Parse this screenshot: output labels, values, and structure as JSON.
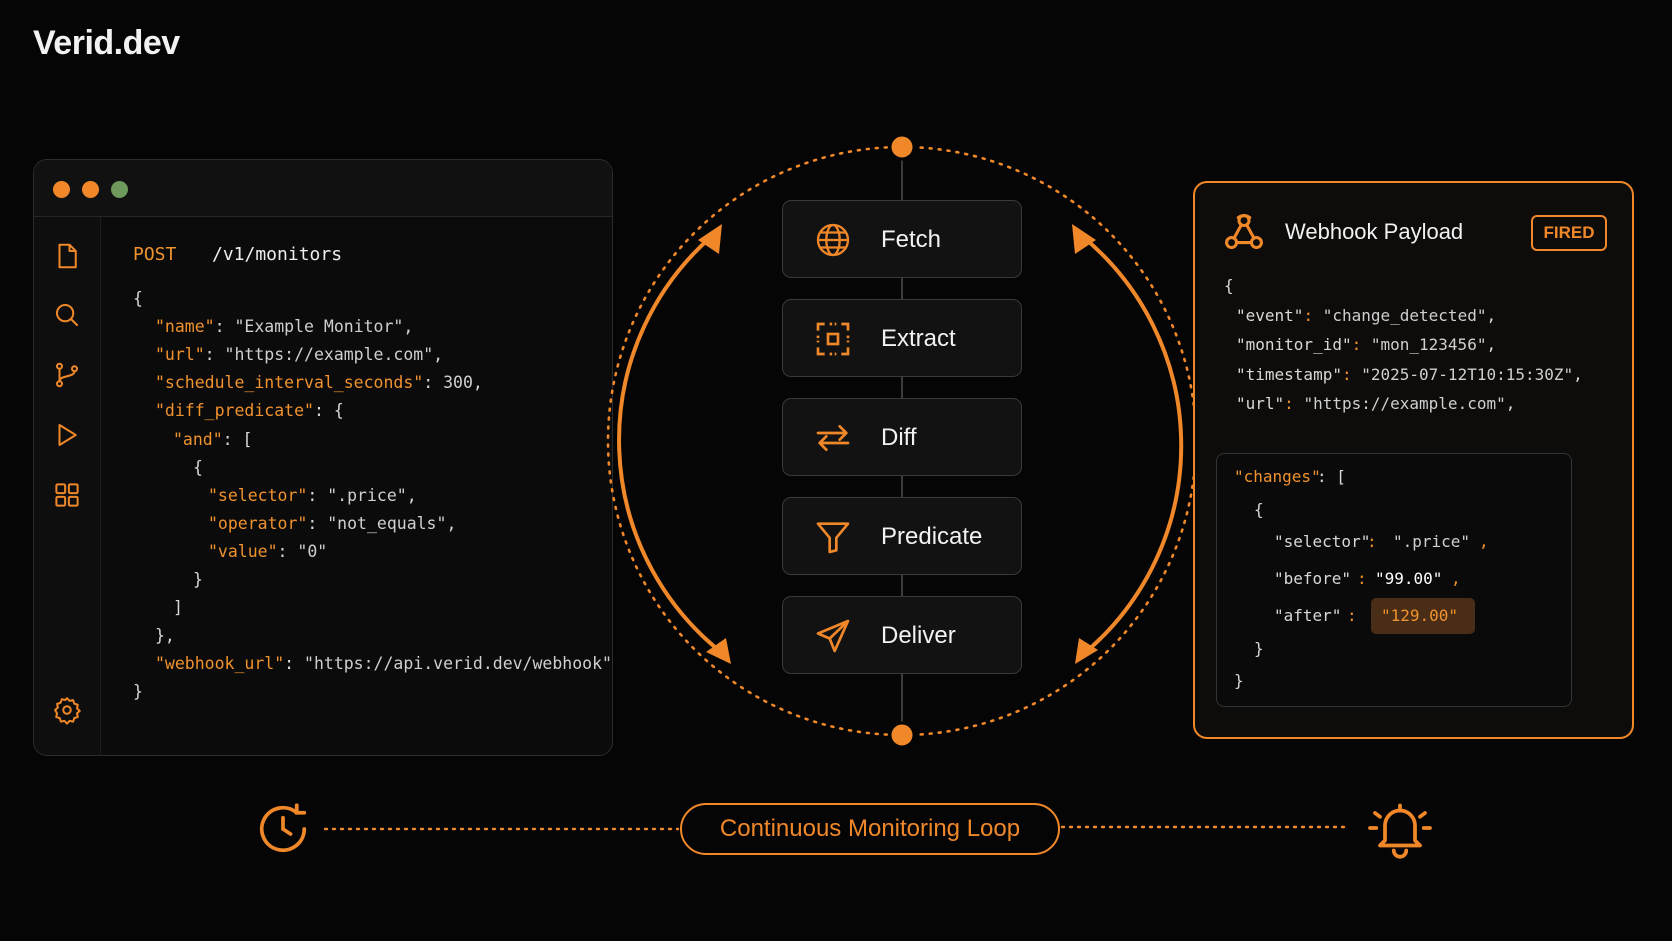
{
  "brand": "Verid.dev",
  "editor": {
    "method": "POST",
    "path": "/v1/monitors",
    "sidebar_icons": [
      "file-icon",
      "search-icon",
      "git-branch-icon",
      "play-icon",
      "grid-icon",
      "settings-icon"
    ],
    "lines": [
      [
        "{"
      ],
      [
        "\"name\"",
        ": ",
        "\"Example Monitor\"",
        ","
      ],
      [
        "\"url\"",
        ": ",
        "\"https://example.com\"",
        ","
      ],
      [
        "\"schedule_interval_seconds\"",
        ": ",
        "300",
        ","
      ],
      [
        "\"diff_predicate\"",
        ": {"
      ],
      [
        "\"and\"",
        ": ["
      ],
      [
        "{"
      ],
      [
        "\"selector\"",
        ": ",
        "\".price\"",
        ","
      ],
      [
        "\"operator\"",
        ": ",
        "\"not_equals\"",
        ","
      ],
      [
        "\"value\"",
        ": ",
        "\"0\""
      ],
      [
        "}"
      ],
      [
        "]"
      ],
      [
        "},"
      ],
      [
        "\"webhook_url\"",
        ": ",
        "\"https://api.verid.dev/webhook\""
      ],
      [
        "}"
      ]
    ]
  },
  "pipeline": {
    "steps": [
      {
        "label": "Fetch",
        "icon": "globe-icon"
      },
      {
        "label": "Extract",
        "icon": "scan-icon"
      },
      {
        "label": "Diff",
        "icon": "arrows-left-right-icon"
      },
      {
        "label": "Predicate",
        "icon": "filter-icon"
      },
      {
        "label": "Deliver",
        "icon": "send-icon"
      }
    ]
  },
  "webhook": {
    "title": "Webhook Payload",
    "status": "FIRED",
    "lines": [
      [
        "{"
      ],
      [
        "\"event\"",
        ": ",
        "\"change_detected\"",
        ","
      ],
      [
        "\"monitor_id\"",
        ": ",
        "\"mon_123456\"",
        ","
      ],
      [
        "\"timestamp\"",
        ": ",
        "\"2025-07-12T10:15:30Z\"",
        ","
      ],
      [
        "\"url\"",
        ": ",
        "\"https://example.com\"",
        ","
      ]
    ],
    "changes": {
      "key": "\"changes\"",
      "open": ": [",
      "obj_open": "{",
      "selector_key": "\"selector\"",
      "selector_val": "\".price\"",
      "before_key": "\"before\"",
      "before_val": "\"99.00\"",
      "after_key": "\"after\"",
      "after_val": "\"129.00\"",
      "obj_close": "}",
      "close": "}",
      "colon": ": ",
      "comma": ","
    }
  },
  "footer": {
    "label": "Continuous Monitoring Loop",
    "left_icon": "clock-refresh-icon",
    "right_icon": "bell-icon"
  },
  "colors": {
    "accent": "#f0882a",
    "background": "#050505",
    "panel": "#121212"
  }
}
